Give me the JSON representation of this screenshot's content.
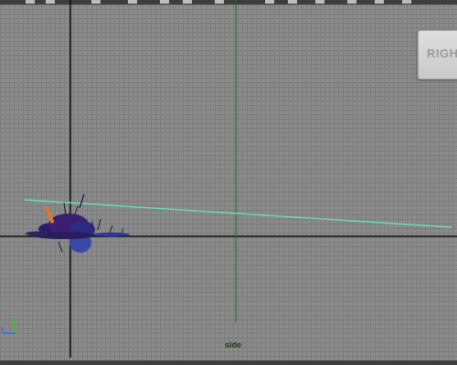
{
  "viewport": {
    "view_cube_label": "RIGHT",
    "camera_name": "side"
  },
  "colors": {
    "background": "#8b8b8b",
    "grid_line": "#7c7c7c",
    "origin_axes": "#111111",
    "camera_line": "#1f6a2a",
    "selected_line": "#66e0b0",
    "mesh": "#3a2070",
    "axis_y": "#2fc32f",
    "axis_z": "#2a6df0"
  },
  "icons": {
    "axis_gizmo": "yz-axis-gizmo-icon",
    "view_cube": "view-cube-icon"
  }
}
